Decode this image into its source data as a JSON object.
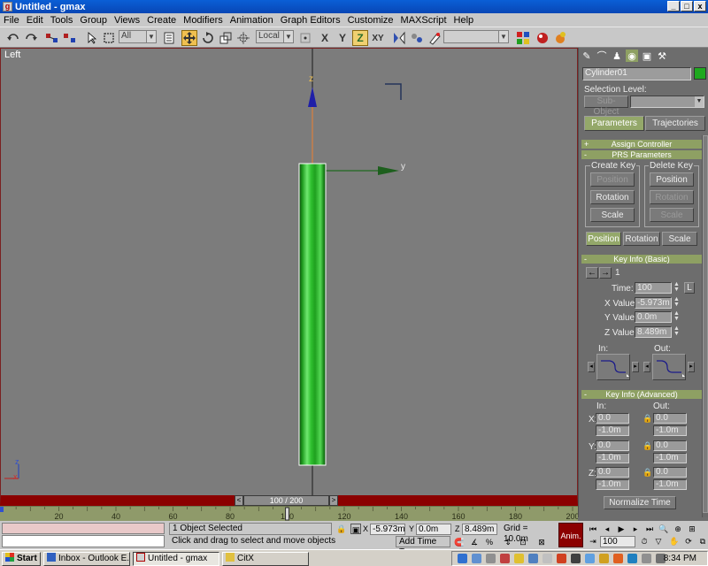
{
  "window": {
    "title": "Untitled - gmax",
    "minimize": "_",
    "maximize": "□",
    "close": "x"
  },
  "menu": [
    "File",
    "Edit",
    "Tools",
    "Group",
    "Views",
    "Create",
    "Modifiers",
    "Animation",
    "Graph Editors",
    "Customize",
    "MAXScript",
    "Help"
  ],
  "toolbar": {
    "selection_filter": "All",
    "coordinate_system": "Local",
    "axis_x": "X",
    "axis_y": "Y",
    "axis_z": "Z",
    "axis_xy": "XY",
    "named_selection": ""
  },
  "viewport": {
    "label": "Left",
    "gizmo_z": "z",
    "gizmo_y": "y",
    "corner_z": "z",
    "corner_x": "x",
    "object_color": "#22b022"
  },
  "command_panel": {
    "object_name": "Cylinder01",
    "object_color": "#1fa81f",
    "selection_level_label": "Selection Level:",
    "sub_object_placeholder": "Sub-Object",
    "parameters_btn": "Parameters",
    "trajectories_btn": "Trajectories",
    "assign_controller": "Assign Controller",
    "assign_controller_sign": "+",
    "prs_parameters": "PRS Parameters",
    "prs_sign": "-",
    "create_key": "Create Key",
    "delete_key": "Delete Key",
    "create_position": "Position",
    "create_rotation": "Rotation",
    "create_scale": "Scale",
    "delete_position": "Position",
    "delete_rotation": "Rotation",
    "delete_scale": "Scale",
    "mode_position": "Position",
    "mode_rotation": "Rotation",
    "mode_scale": "Scale",
    "key_info_basic": "Key Info (Basic)",
    "key_info_basic_sign": "-",
    "key_number": "1",
    "time_label": "Time:",
    "time_value": "100",
    "lock_label": "L",
    "xvalue_label": "X Value:",
    "xvalue": "-5.973m",
    "yvalue_label": "Y Value:",
    "yvalue": "0.0m",
    "zvalue_label": "Z Value:",
    "zvalue": "8.489m",
    "in_label": "In:",
    "out_label": "Out:",
    "key_info_advanced": "Key Info (Advanced)",
    "key_info_advanced_sign": "-",
    "adv_in_label": "In:",
    "adv_out_label": "Out:",
    "adv_x": "X:",
    "adv_y": "Y:",
    "adv_z": "Z:",
    "adv_in_x": "0.0",
    "adv_in_x2": "-1.0m",
    "adv_out_x": "0.0",
    "adv_out_x2": "-1.0m",
    "adv_in_y": "0.0",
    "adv_in_y2": "-1.0m",
    "adv_out_y": "0.0",
    "adv_out_y2": "-1.0m",
    "adv_in_z": "0.0",
    "adv_in_z2": "-1.0m",
    "adv_out_z": "0.0",
    "adv_out_z2": "-1.0m",
    "normalize_time": "Normalize Time"
  },
  "timeline": {
    "slider_label": "100 / 200",
    "ticks": [
      "20",
      "40",
      "60",
      "80",
      "100",
      "120",
      "140",
      "160",
      "180",
      "200"
    ],
    "current_frame": 100,
    "total_frames": 200
  },
  "status": {
    "selection": "1 Object Selected",
    "prompt": "Click and drag to select and move objects",
    "x_label": "X",
    "x_value": "-5.973m",
    "y_label": "Y",
    "y_value": "0.0m",
    "z_label": "Z",
    "z_value": "8.489m",
    "grid": "Grid = 10.0m",
    "add_time_tag": "Add Time Tag",
    "anim": "Anim.",
    "frame": "100"
  },
  "taskbar": {
    "start": "Start",
    "items": [
      "Inbox - Outlook E...",
      "Untitled - gmax",
      "CitX"
    ],
    "clock": "8:34 PM"
  }
}
